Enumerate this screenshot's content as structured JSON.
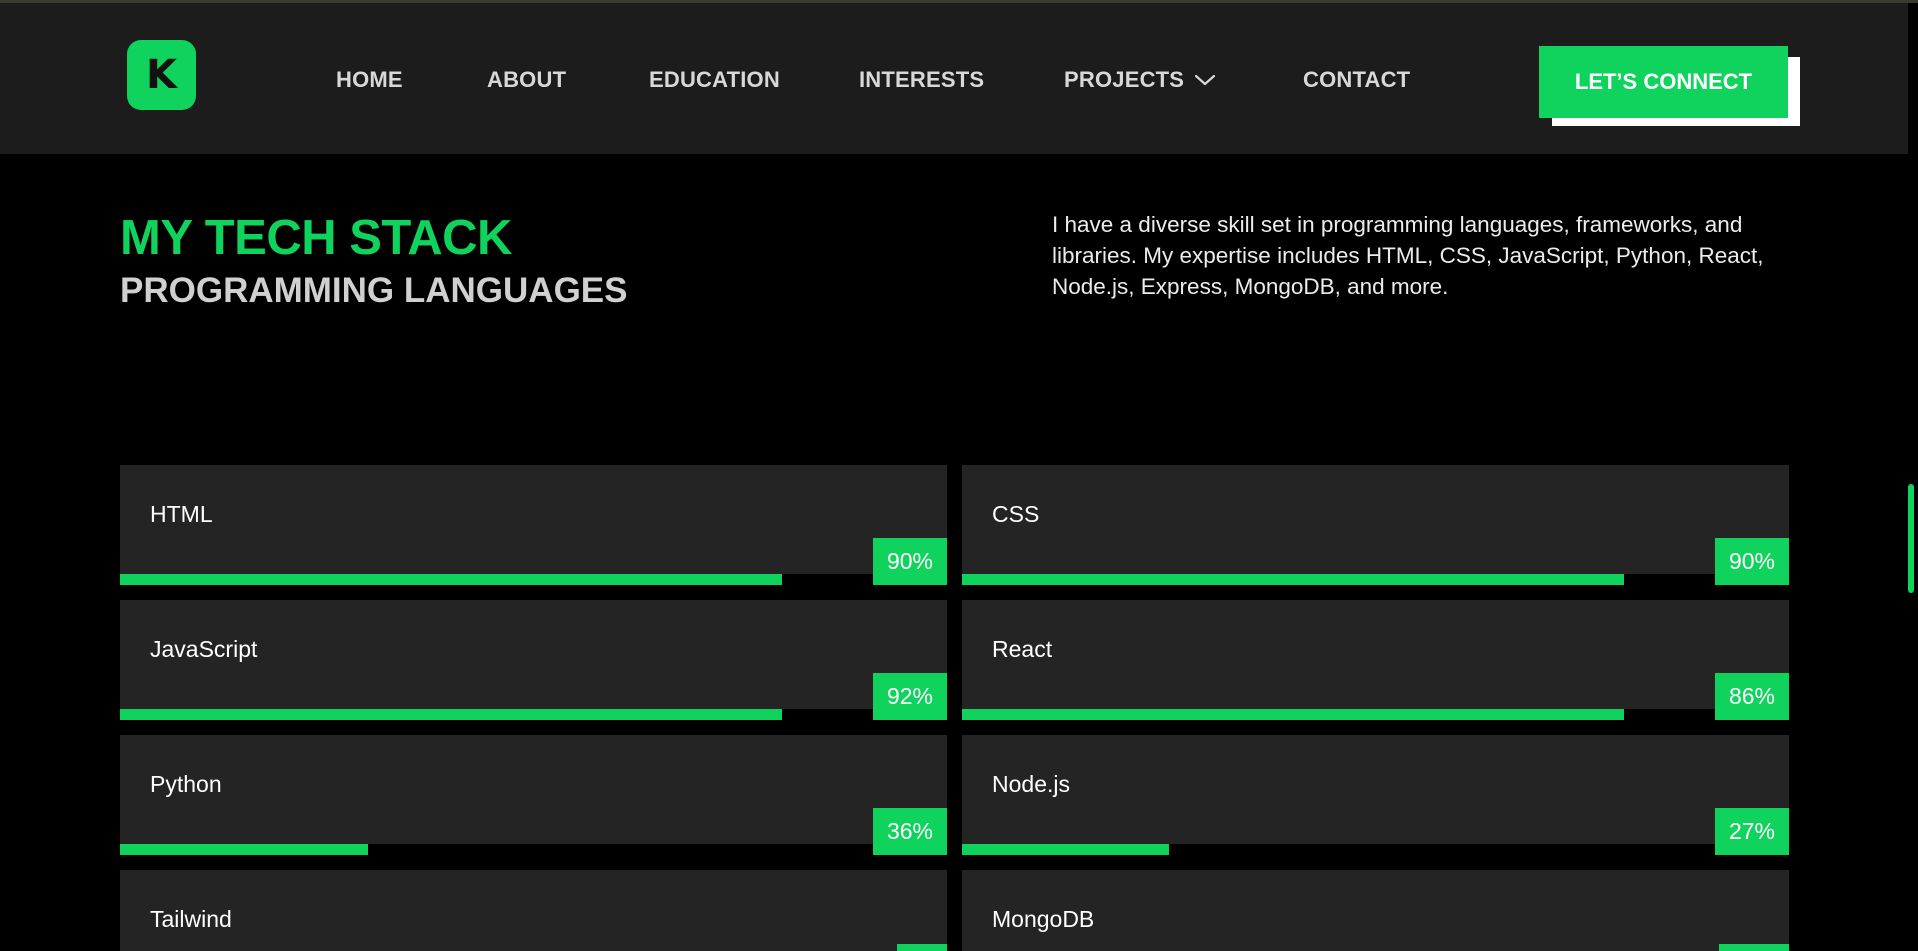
{
  "logo": {
    "letter": "K"
  },
  "nav": {
    "home": "HOME",
    "about": "ABOUT",
    "education": "EDUCATION",
    "interests": "INTERESTS",
    "projects": "PROJECTS",
    "contact": "CONTACT",
    "connect": "LET’S CONNECT"
  },
  "section": {
    "title": "MY TECH STACK",
    "subtitle": "PROGRAMMING LANGUAGES",
    "description": "I have a diverse skill set in programming languages, frameworks, and libraries. My expertise includes HTML, CSS, JavaScript, Python, React, Node.js, Express, MongoDB, and more."
  },
  "skills": [
    {
      "name": "HTML",
      "percent": "90%",
      "bar_fill": 0.8
    },
    {
      "name": "CSS",
      "percent": "90%",
      "bar_fill": 0.8
    },
    {
      "name": "JavaScript",
      "percent": "92%",
      "bar_fill": 0.8
    },
    {
      "name": "React",
      "percent": "86%",
      "bar_fill": 0.8
    },
    {
      "name": "Python",
      "percent": "36%",
      "bar_fill": 0.3
    },
    {
      "name": "Node.js",
      "percent": "27%",
      "bar_fill": 0.25
    },
    {
      "name": "Tailwind",
      "percent": "",
      "bar_fill": 0
    },
    {
      "name": "MongoDB",
      "percent": "",
      "bar_fill": 0
    }
  ],
  "colors": {
    "accent": "#0fd35d",
    "navbar": "#1c1c1d",
    "card": "#242424",
    "background": "#000000"
  },
  "icons": {
    "projects_dropdown": "chevron-down-icon"
  }
}
